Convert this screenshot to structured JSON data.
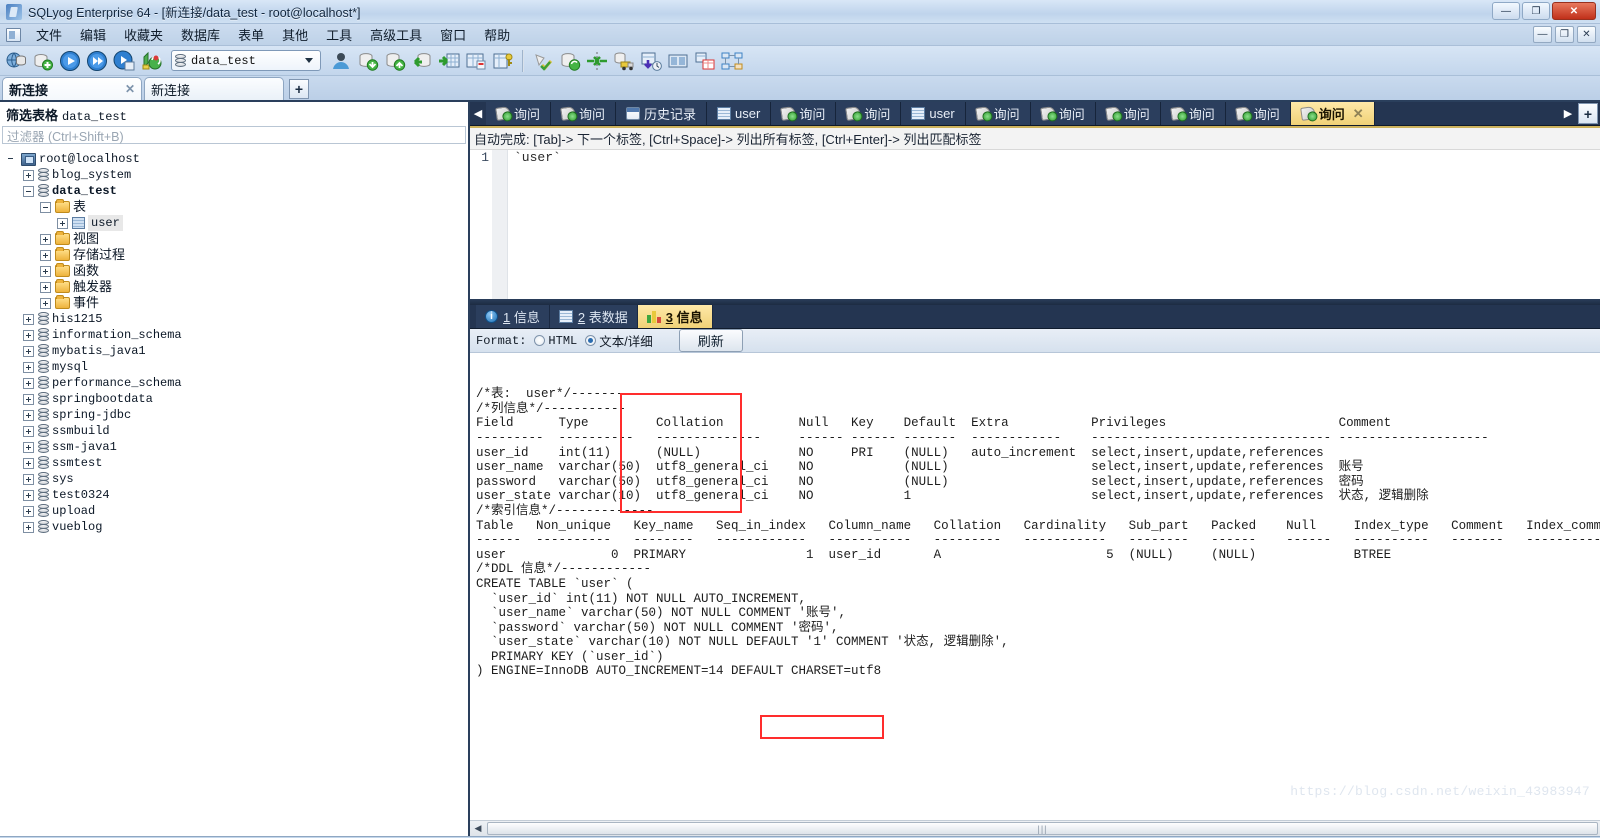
{
  "window": {
    "title": "SQLyog Enterprise 64 - [新连接/data_test - root@localhost*]",
    "minimize": "—",
    "maximize": "❐",
    "close": "✕",
    "sub_minimize": "—",
    "sub_restore": "❐",
    "sub_close": "✕"
  },
  "menu": {
    "items": [
      {
        "label": "文件"
      },
      {
        "label": "编辑"
      },
      {
        "label": "收藏夹"
      },
      {
        "label": "数据库"
      },
      {
        "label": "表单"
      },
      {
        "label": "其他"
      },
      {
        "label": "工具"
      },
      {
        "label": "高级工具"
      },
      {
        "label": "窗口"
      },
      {
        "label": "帮助"
      }
    ]
  },
  "toolbar": {
    "db_selector_value": "data_test",
    "icons": [
      "connection-manager-icon",
      "new-connection-icon",
      "execute-query-icon",
      "execute-all-icon",
      "execute-stepwise-icon",
      "refresh-object-browser-icon"
    ],
    "icons_right": [
      "user-manager-icon",
      "backup-database-icon",
      "restore-database-icon",
      "import-external-data-icon",
      "export-table-data-icon",
      "table-diagnostics-icon",
      "schema-designer-icon"
    ],
    "icons_group3": [
      "sql-formatter-icon",
      "sync-database-icon",
      "schema-sync-icon",
      "data-transfer-icon",
      "scheduled-backup-icon",
      "visual-data-compare-icon",
      "query-builder-icon",
      "er-diagram-icon"
    ]
  },
  "connections": {
    "active_tab": "新连接",
    "active_close": "✕",
    "second_tab": "新连接",
    "add_label": "+"
  },
  "sidebar": {
    "filter_title_label": "筛选表格",
    "filter_title_value": "data_test",
    "filter_placeholder": "过滤器 (Ctrl+Shift+B)",
    "tree": [
      {
        "label": "root@localhost",
        "icon": "server-icon",
        "indent": 0,
        "expander": "none",
        "bold": false,
        "cjk": false
      },
      {
        "label": "blog_system",
        "icon": "database-icon",
        "indent": 1,
        "expander": "plus",
        "bold": false,
        "cjk": false
      },
      {
        "label": "data_test",
        "icon": "database-icon",
        "indent": 1,
        "expander": "minus",
        "bold": true,
        "cjk": false
      },
      {
        "label": "表",
        "icon": "folder-icon",
        "indent": 2,
        "expander": "minus",
        "bold": false,
        "cjk": true
      },
      {
        "label": "user",
        "icon": "table-icon",
        "indent": 3,
        "expander": "plus",
        "bold": false,
        "cjk": false,
        "selected": true
      },
      {
        "label": "视图",
        "icon": "folder-icon",
        "indent": 2,
        "expander": "plus",
        "bold": false,
        "cjk": true
      },
      {
        "label": "存储过程",
        "icon": "folder-icon",
        "indent": 2,
        "expander": "plus",
        "bold": false,
        "cjk": true
      },
      {
        "label": "函数",
        "icon": "folder-icon",
        "indent": 2,
        "expander": "plus",
        "bold": false,
        "cjk": true
      },
      {
        "label": "触发器",
        "icon": "folder-icon",
        "indent": 2,
        "expander": "plus",
        "bold": false,
        "cjk": true
      },
      {
        "label": "事件",
        "icon": "folder-icon",
        "indent": 2,
        "expander": "plus",
        "bold": false,
        "cjk": true
      },
      {
        "label": "his1215",
        "icon": "database-icon",
        "indent": 1,
        "expander": "plus",
        "bold": false,
        "cjk": false
      },
      {
        "label": "information_schema",
        "icon": "database-icon",
        "indent": 1,
        "expander": "plus",
        "bold": false,
        "cjk": false
      },
      {
        "label": "mybatis_java1",
        "icon": "database-icon",
        "indent": 1,
        "expander": "plus",
        "bold": false,
        "cjk": false
      },
      {
        "label": "mysql",
        "icon": "database-icon",
        "indent": 1,
        "expander": "plus",
        "bold": false,
        "cjk": false
      },
      {
        "label": "performance_schema",
        "icon": "database-icon",
        "indent": 1,
        "expander": "plus",
        "bold": false,
        "cjk": false
      },
      {
        "label": "springbootdata",
        "icon": "database-icon",
        "indent": 1,
        "expander": "plus",
        "bold": false,
        "cjk": false
      },
      {
        "label": "spring-jdbc",
        "icon": "database-icon",
        "indent": 1,
        "expander": "plus",
        "bold": false,
        "cjk": false
      },
      {
        "label": "ssmbuild",
        "icon": "database-icon",
        "indent": 1,
        "expander": "plus",
        "bold": false,
        "cjk": false
      },
      {
        "label": "ssm-java1",
        "icon": "database-icon",
        "indent": 1,
        "expander": "plus",
        "bold": false,
        "cjk": false
      },
      {
        "label": "ssmtest",
        "icon": "database-icon",
        "indent": 1,
        "expander": "plus",
        "bold": false,
        "cjk": false
      },
      {
        "label": "sys",
        "icon": "database-icon",
        "indent": 1,
        "expander": "plus",
        "bold": false,
        "cjk": false
      },
      {
        "label": "test0324",
        "icon": "database-icon",
        "indent": 1,
        "expander": "plus",
        "bold": false,
        "cjk": false
      },
      {
        "label": "upload",
        "icon": "database-icon",
        "indent": 1,
        "expander": "plus",
        "bold": false,
        "cjk": false
      },
      {
        "label": "vueblog",
        "icon": "database-icon",
        "indent": 1,
        "expander": "plus",
        "bold": false,
        "cjk": false
      }
    ]
  },
  "query_tabs": {
    "scroll_left": "◀",
    "scroll_right": "▶",
    "add": "+",
    "items": [
      {
        "label": "询问",
        "icon": "query-icon",
        "active": false
      },
      {
        "label": "询问",
        "icon": "query-icon",
        "active": false
      },
      {
        "label": "历史记录",
        "icon": "history-icon",
        "active": false
      },
      {
        "label": "user",
        "icon": "table-icon",
        "active": false
      },
      {
        "label": "询问",
        "icon": "query-icon",
        "active": false
      },
      {
        "label": "询问",
        "icon": "query-icon",
        "active": false
      },
      {
        "label": "user",
        "icon": "table-icon",
        "active": false
      },
      {
        "label": "询问",
        "icon": "query-icon",
        "active": false
      },
      {
        "label": "询问",
        "icon": "query-icon",
        "active": false
      },
      {
        "label": "询问",
        "icon": "query-icon",
        "active": false
      },
      {
        "label": "询问",
        "icon": "query-icon",
        "active": false
      },
      {
        "label": "询问",
        "icon": "query-icon",
        "active": false
      },
      {
        "label": "询问",
        "icon": "query-icon",
        "active": true,
        "close": "✕"
      }
    ]
  },
  "editor": {
    "autocomplete_hint": "自动完成: [Tab]-> 下一个标签, [Ctrl+Space]-> 列出所有标签, [Ctrl+Enter]-> 列出匹配标签",
    "line_number": "1",
    "code": "`user`"
  },
  "result_tabs": [
    {
      "num": "1",
      "label": "信息",
      "icon": "info-icon",
      "active": false
    },
    {
      "num": "2",
      "label": "表数据",
      "icon": "table-icon",
      "active": false
    },
    {
      "num": "3",
      "label": "信息",
      "icon": "chart-icon",
      "active": true
    }
  ],
  "format_bar": {
    "label": "Format:",
    "option_html": "HTML",
    "option_text": "文本/详细",
    "selected": "text",
    "refresh_button": "刷新"
  },
  "output": {
    "table_header_comment": "/*表:  user*/-------------",
    "columns_comment": "/*列信息*/-----------",
    "index_comment": "/*索引信息*/-------------",
    "ddl_comment": "/*DDL 信息*/------------",
    "columns_table": {
      "headers": [
        "Field",
        "Type",
        "Collation",
        "Null",
        "Key",
        "Default",
        "Extra",
        "Privileges",
        "Comment"
      ],
      "rules": [
        "---------",
        "----------",
        "--------------",
        "------",
        "------",
        "-------",
        "------------",
        "--------------------------------",
        "--------------------"
      ],
      "rows": [
        [
          "user_id",
          "int(11)",
          "(NULL)",
          "NO",
          "PRI",
          "(NULL)",
          "auto_increment",
          "select,insert,update,references",
          ""
        ],
        [
          "user_name",
          "varchar(50)",
          "utf8_general_ci",
          "NO",
          "",
          "(NULL)",
          "",
          "select,insert,update,references",
          "账号"
        ],
        [
          "password",
          "varchar(50)",
          "utf8_general_ci",
          "NO",
          "",
          "(NULL)",
          "",
          "select,insert,update,references",
          "密码"
        ],
        [
          "user_state",
          "varchar(10)",
          "utf8_general_ci",
          "NO",
          "",
          "1",
          "",
          "select,insert,update,references",
          "状态, 逻辑删除"
        ]
      ]
    },
    "index_table": {
      "headers": [
        "Table",
        "Non_unique",
        "Key_name",
        "Seq_in_index",
        "Column_name",
        "Collation",
        "Cardinality",
        "Sub_part",
        "Packed",
        "Null",
        "Index_type",
        "Comment",
        "Index_comment"
      ],
      "rules": [
        "------",
        "----------",
        "--------",
        "------------",
        "-----------",
        "---------",
        "-----------",
        "--------",
        "------",
        "------",
        "----------",
        "-------",
        "--------------"
      ],
      "rows": [
        [
          "user",
          "0",
          "PRIMARY",
          "1",
          "user_id",
          "A",
          "5",
          "(NULL)",
          "(NULL)",
          "",
          "BTREE",
          "",
          ""
        ]
      ]
    },
    "ddl_lines": [
      "CREATE TABLE `user` (",
      "  `user_id` int(11) NOT NULL AUTO_INCREMENT,",
      "  `user_name` varchar(50) NOT NULL COMMENT '账号',",
      "  `password` varchar(50) NOT NULL COMMENT '密码',",
      "  `user_state` varchar(10) NOT NULL DEFAULT '1' COMMENT '状态, 逻辑删除',",
      "  PRIMARY KEY (`user_id`)",
      ") ENGINE=InnoDB AUTO_INCREMENT=14 DEFAULT CHARSET=utf8"
    ],
    "highlight_color": "#ff2d2d",
    "highlight_targets": [
      "collation-column",
      "charset-utf8"
    ],
    "watermark": "https://blog.csdn.net/weixin_43983947"
  },
  "scrollbar": {
    "left_arrow": "◀",
    "thumb_grip": "|||"
  }
}
